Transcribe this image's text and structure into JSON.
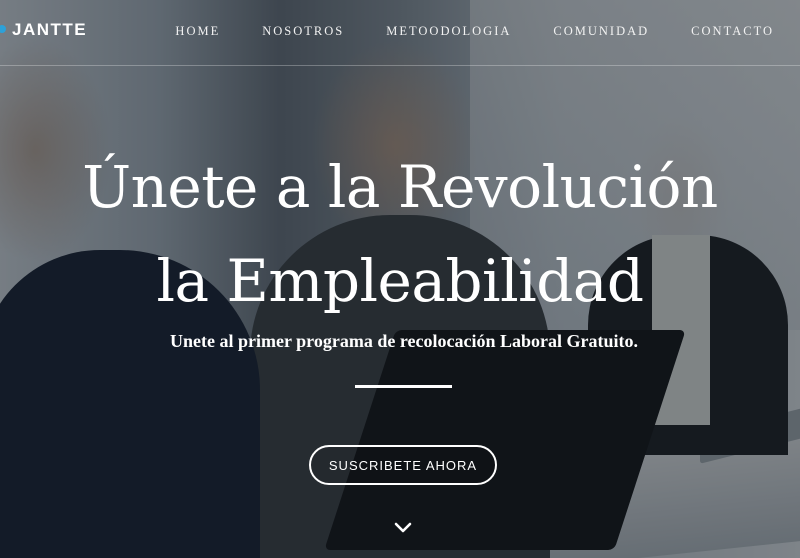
{
  "brand": {
    "name": "JANTTE",
    "accent_color": "#2da1d8"
  },
  "nav": {
    "items": [
      {
        "label": "HOME"
      },
      {
        "label": "NOSOTROS"
      },
      {
        "label": "METOODOLOGIA"
      },
      {
        "label": "COMUNIDAD"
      },
      {
        "label": "CONTACTO"
      }
    ]
  },
  "hero": {
    "title_line1": "Únete a la Revolución",
    "title_line2": "la Empleabilidad",
    "subtitle": "Unete al primer programa de recolocación Laboral Gratuito.",
    "cta_label": "SUSCRIBETE AHORA",
    "scroll_icon": "chevron-down-icon"
  }
}
